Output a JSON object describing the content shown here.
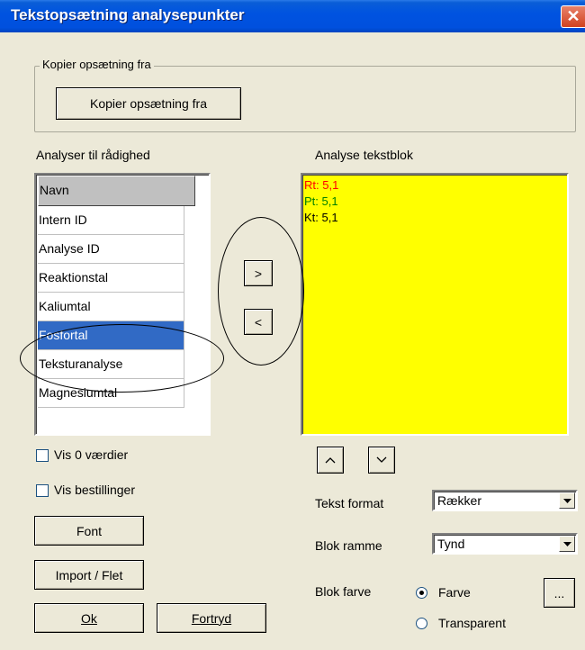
{
  "window": {
    "title": "Tekstopsætning analysepunkter",
    "close_glyph": "✕"
  },
  "copy_group": {
    "label": "Kopier opsætning fra",
    "button_label": "Kopier opsætning fra"
  },
  "available": {
    "label": "Analyser til rådighed",
    "header": "Navn",
    "items": [
      "Intern ID",
      "Analyse ID",
      "Reaktionstal",
      "Kaliumtal",
      "Fosfortal",
      "Teksturanalyse",
      "Magnesiumtal"
    ],
    "selected_index": 4
  },
  "transfer": {
    "add_glyph": ">",
    "remove_glyph": "<"
  },
  "textblock": {
    "label": "Analyse tekstblok",
    "lines": [
      {
        "text": "Rt: 5,1",
        "color": "#ff0000"
      },
      {
        "text": "Pt: 5,1",
        "color": "#008000"
      },
      {
        "text": "Kt: 5,1",
        "color": "#000000"
      }
    ],
    "background": "#ffff00"
  },
  "order": {
    "up_icon": "chevron-up-icon",
    "down_icon": "chevron-down-icon"
  },
  "options": {
    "show_zero_label": "Vis 0 værdier",
    "show_zero_checked": false,
    "show_orders_label": "Vis bestillinger",
    "show_orders_checked": false
  },
  "buttons": {
    "font": "Font",
    "import_merge": "Import / Flet",
    "ok": "Ok",
    "cancel": "Fortryd",
    "color_picker": "..."
  },
  "format": {
    "text_format_label": "Tekst format",
    "text_format_value": "Rækker",
    "block_frame_label": "Blok ramme",
    "block_frame_value": "Tynd",
    "block_color_label": "Blok farve",
    "color_option": "Farve",
    "transparent_option": "Transparent",
    "selected_option": "Farve"
  },
  "colors": {
    "title_bar": "#0053e0",
    "dialog_bg": "#ece9d8",
    "selection": "#316ac5",
    "close_button": "#d1411f"
  }
}
